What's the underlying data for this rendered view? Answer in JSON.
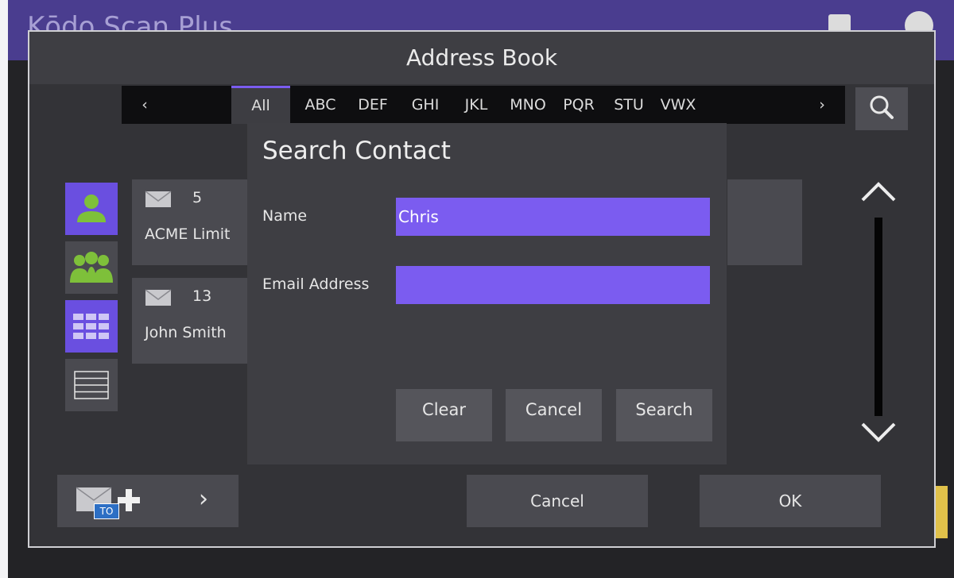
{
  "app": {
    "title": "Kōdo Scan Plus"
  },
  "dialog": {
    "title": "Address Book",
    "alphabet": {
      "prev_label": "‹",
      "next_label": "›",
      "tabs": [
        "All",
        "ABC",
        "DEF",
        "GHI",
        "JKL",
        "MNO",
        "PQR",
        "STU",
        "VWX"
      ],
      "active_tab": "All"
    },
    "search_icon": "search-icon",
    "view_buttons": [
      {
        "name": "single-contact-icon",
        "active": true
      },
      {
        "name": "group-contacts-icon",
        "active": false
      },
      {
        "name": "grid-view-icon",
        "active": true
      },
      {
        "name": "list-view-icon",
        "active": false
      }
    ],
    "contacts": [
      {
        "count": "5",
        "name": "ACME Limit"
      },
      {
        "count": "13",
        "name": "John Smith"
      }
    ],
    "bottom": {
      "add_recipient_icon": "mail-to-add-icon",
      "add_recipient_chevron": "›",
      "to_badge": "TO",
      "cancel_label": "Cancel",
      "ok_label": "OK"
    }
  },
  "search_modal": {
    "title": "Search Contact",
    "name_label": "Name",
    "name_value": "Chris",
    "email_label": "Email Address",
    "email_value": "",
    "clear_label": "Clear",
    "cancel_label": "Cancel",
    "search_label": "Search"
  },
  "colors": {
    "accent": "#7b5cf0",
    "icon_green": "#7ec03a",
    "header_purple": "#4a3d8f"
  }
}
